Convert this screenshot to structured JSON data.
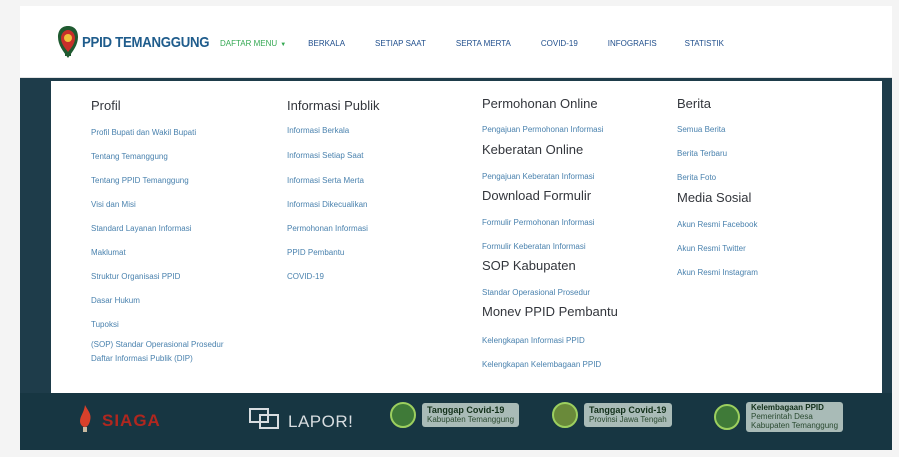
{
  "brand": {
    "name": "PPID TEMANGGUNG"
  },
  "nav": {
    "items": [
      {
        "label": "DAFTAR MENU",
        "active": true,
        "has_caret": true
      },
      {
        "label": "BERKALA"
      },
      {
        "label": "SETIAP SAAT"
      },
      {
        "label": "SERTA MERTA"
      },
      {
        "label": "COVID-19"
      },
      {
        "label": "INFOGRAFIS"
      },
      {
        "label": "STATISTIK"
      }
    ]
  },
  "menu": {
    "profil": {
      "title": "Profil",
      "links": [
        "Profil Bupati dan Wakil Bupati",
        "Tentang Temanggung",
        "Tentang PPID Temanggung",
        "Visi dan Misi",
        "Standard Layanan Informasi",
        "Maklumat",
        "Struktur Organisasi PPID",
        "Dasar Hukum",
        "Tupoksi",
        "(SOP) Standar Operasional Prosedur",
        "Daftar Informasi Publik (DIP)"
      ]
    },
    "informasi": {
      "title": "Informasi Publik",
      "links": [
        "Informasi Berkala",
        "Informasi Setiap Saat",
        "Informasi Serta Merta",
        "Informasi Dikecualikan",
        "Permohonan Informasi",
        "PPID Pembantu",
        "COVID-19"
      ]
    },
    "permohonan": {
      "sections": [
        {
          "title": "Permohonan Online",
          "links": [
            "Pengajuan Permohonan Informasi"
          ]
        },
        {
          "title": "Keberatan Online",
          "links": [
            "Pengajuan Keberatan Informasi"
          ]
        },
        {
          "title": "Download Formulir",
          "links": [
            "Formulir Permohonan Informasi",
            "Formulir Keberatan Informasi"
          ]
        },
        {
          "title": "SOP Kabupaten",
          "links": [
            "Standar Operasional Prosedur"
          ]
        },
        {
          "title": "Monev PPID Pembantu",
          "links": [
            "Kelengkapan Informasi PPID",
            "Kelengkapan Kelembagaan PPID"
          ]
        }
      ]
    },
    "berita": {
      "sections": [
        {
          "title": "Berita",
          "links": [
            "Semua Berita",
            "Berita Terbaru",
            "Berita Foto"
          ]
        },
        {
          "title": "Media Sosial",
          "links": [
            "Akun Resmi Facebook",
            "Akun Resmi Twitter",
            "Akun Resmi Instagram"
          ]
        }
      ]
    }
  },
  "footer": {
    "siaga": "SIAGA",
    "lapor": "LAPOR!",
    "covid_kab": {
      "line1": "Tanggap Covid-19",
      "line2": "Kabupaten Temanggung"
    },
    "covid_prov": {
      "line1": "Tanggap Covid-19",
      "line2": "Provinsi Jawa Tengah"
    },
    "kelembagaan": {
      "line1": "Kelembagaan PPID",
      "line2": "Pemerintah Desa",
      "line3": "Kabupaten Temanggung"
    }
  },
  "colors": {
    "nav_link": "#1f4e8c",
    "nav_active": "#35a853",
    "menu_link": "#4a82ae",
    "heading": "#33363c",
    "dark_band": "#1e3c4a",
    "footer_bg": "#173642"
  }
}
